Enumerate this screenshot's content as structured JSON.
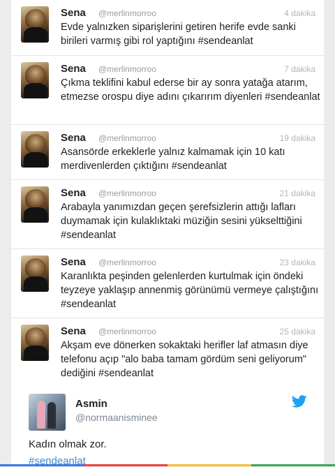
{
  "tweets": [
    {
      "name": "Sena",
      "handle": "@merlinmorroo",
      "time": "4 dakika",
      "text": "Evde yalnızken siparişlerini getiren herife evde sanki birileri varmış gibi rol yaptığını #sendeanlat"
    },
    {
      "name": "Sena",
      "handle": "@merlinmorroo",
      "time": "7 dakika",
      "text": "Çıkma teklifini kabul ederse bir ay sonra yatağa atarım, etmezse orospu diye adını çıkarırım diyenleri #sendeanlat"
    },
    {
      "name": "Sena",
      "handle": "@merlinmorroo",
      "time": "19 dakika",
      "text": "Asansörde erkeklerle yalnız kalmamak için 10 katı merdivenlerden çıktığını #sendeanlat"
    },
    {
      "name": "Sena",
      "handle": "@merlinmorroo",
      "time": "21 dakika",
      "text": "Arabayla yanımızdan geçen şerefsizlerin attığı lafları duymamak için kulaklıktaki müziğin sesini yükselttiğini #sendeanlat"
    },
    {
      "name": "Sena",
      "handle": "@merlinmorroo",
      "time": "23 dakika",
      "text": "Karanlıkta peşinden gelenlerden kurtulmak için öndeki teyzeye yaklaşıp annenmiş görünümü vermeye çalıştığını #sendeanlat"
    },
    {
      "name": "Sena",
      "handle": "@merlinmorroo",
      "time": "25 dakika",
      "text": "Akşam eve dönerken sokaktaki herifler laf atmasın diye telefonu açıp \"alo baba tamam gördüm seni geliyorum\" dediğini #sendeanlat"
    }
  ],
  "quote": {
    "name": "Asmin",
    "handle": "@normaanisminee",
    "text": "Kadın olmak zor.",
    "hashtag": "#sendeanlat",
    "icon": "twitter-bird-icon"
  },
  "colors": {
    "twitter_blue": "#1da1f2",
    "hashtag_blue": "#3a8ad0",
    "accent_bar": [
      "#3b78e7",
      "#e8453c",
      "#f9bb2d",
      "#3aa757"
    ]
  }
}
